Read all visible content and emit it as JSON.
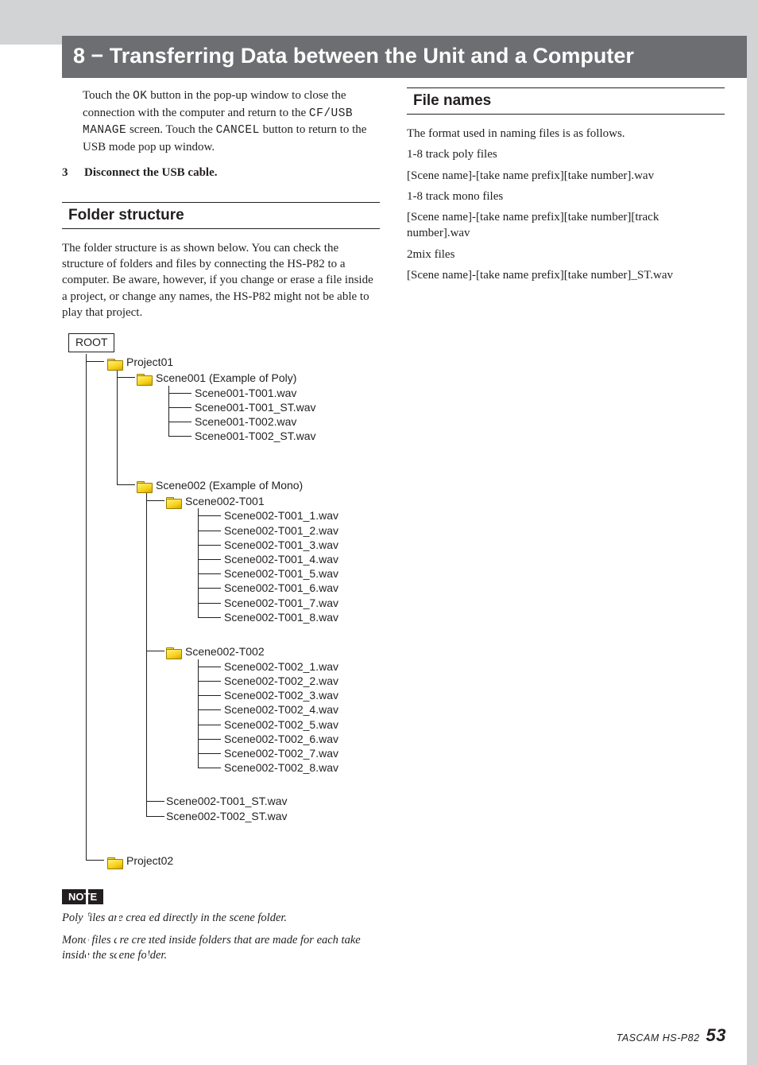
{
  "chapter_title": "8 − Transferring Data between the Unit and a Computer",
  "intro": {
    "p1a": "Touch the ",
    "ok": "OK",
    "p1b": " button in the pop-up window to close the connection with the computer and return to the ",
    "cfusb": "CF/USB MANAGE",
    "p1c": " screen. Touch the ",
    "cancel": "CANCEL",
    "p1d": " button to return to the USB mode pop up window."
  },
  "step3_num": "3",
  "step3_text": "Disconnect the USB cable.",
  "folder_heading": "Folder structure",
  "folder_para": "The folder structure is as shown below. You can check the structure of folders and files by connecting the HS-P82 to a computer. Be aware, however, if you change or erase a file inside a project, or change any names, the HS-P82 might not be able to play that project.",
  "tree": {
    "root": "ROOT",
    "project01": "Project01",
    "scene001_label": "Scene001 (Example of Poly)",
    "scene001_files": [
      "Scene001-T001.wav",
      "Scene001-T001_ST.wav",
      "Scene001-T002.wav",
      "Scene001-T002_ST.wav"
    ],
    "scene002_label": "Scene002 (Example of Mono)",
    "scene002_t001": "Scene002-T001",
    "scene002_t001_files": [
      "Scene002-T001_1.wav",
      "Scene002-T001_2.wav",
      "Scene002-T001_3.wav",
      "Scene002-T001_4.wav",
      "Scene002-T001_5.wav",
      "Scene002-T001_6.wav",
      "Scene002-T001_7.wav",
      "Scene002-T001_8.wav"
    ],
    "scene002_t002": "Scene002-T002",
    "scene002_t002_files": [
      "Scene002-T002_1.wav",
      "Scene002-T002_2.wav",
      "Scene002-T002_3.wav",
      "Scene002-T002_4.wav",
      "Scene002-T002_5.wav",
      "Scene002-T002_6.wav",
      "Scene002-T002_7.wav",
      "Scene002-T002_8.wav"
    ],
    "scene002_st_files": [
      "Scene002-T001_ST.wav",
      "Scene002-T002_ST.wav"
    ],
    "project02": "Project02"
  },
  "note_label": "NOTE",
  "note1": "Poly files are created directly in the scene folder.",
  "note2": "Mono files are created inside folders that are made for each take inside the scene folder.",
  "file_heading": "File names",
  "file_lines": [
    "The format used in naming files is as follows.",
    "1-8 track poly files",
    "[Scene name]-[take name prefix][take number].wav",
    "1-8 track mono files",
    "[Scene name]-[take name prefix][take number][track number].wav",
    "2mix files",
    "[Scene name]-[take name prefix][take number]_ST.wav"
  ],
  "footer_model": "TASCAM  HS-P82",
  "footer_page": "53"
}
